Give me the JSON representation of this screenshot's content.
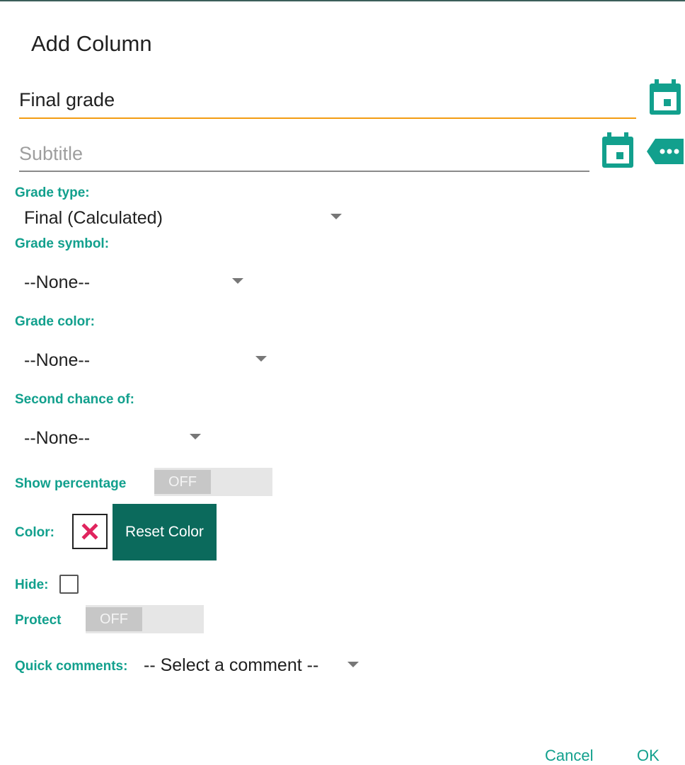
{
  "dialog": {
    "title": "Add Column",
    "title_field": {
      "value": "Final grade"
    },
    "subtitle_field": {
      "placeholder": "Subtitle"
    },
    "grade_type": {
      "label": "Grade type:",
      "selected": "Final  (Calculated)"
    },
    "grade_symbol": {
      "label": "Grade symbol:",
      "selected": "--None--"
    },
    "grade_color": {
      "label": "Grade color:",
      "selected": "--None--"
    },
    "second_chance": {
      "label": "Second chance of:",
      "selected": "--None--"
    },
    "show_percentage": {
      "label": "Show percentage",
      "state": "OFF"
    },
    "color": {
      "label": "Color:",
      "reset_label": "Reset Color"
    },
    "hide": {
      "label": "Hide:",
      "checked": false
    },
    "protect": {
      "label": "Protect",
      "state": "OFF"
    },
    "quick_comments": {
      "label": "Quick comments:",
      "selected": "-- Select a comment --"
    },
    "actions": {
      "cancel": "Cancel",
      "ok": "OK"
    }
  },
  "colors": {
    "accent": "#12a08d",
    "primary_dark": "#0b6a5c",
    "focus_underline": "#f39c12",
    "clear_mark": "#e0245e"
  },
  "icons": [
    "calendar-icon",
    "calendar-icon",
    "tag-more-icon",
    "close-x-icon",
    "dropdown-caret-icon"
  ]
}
